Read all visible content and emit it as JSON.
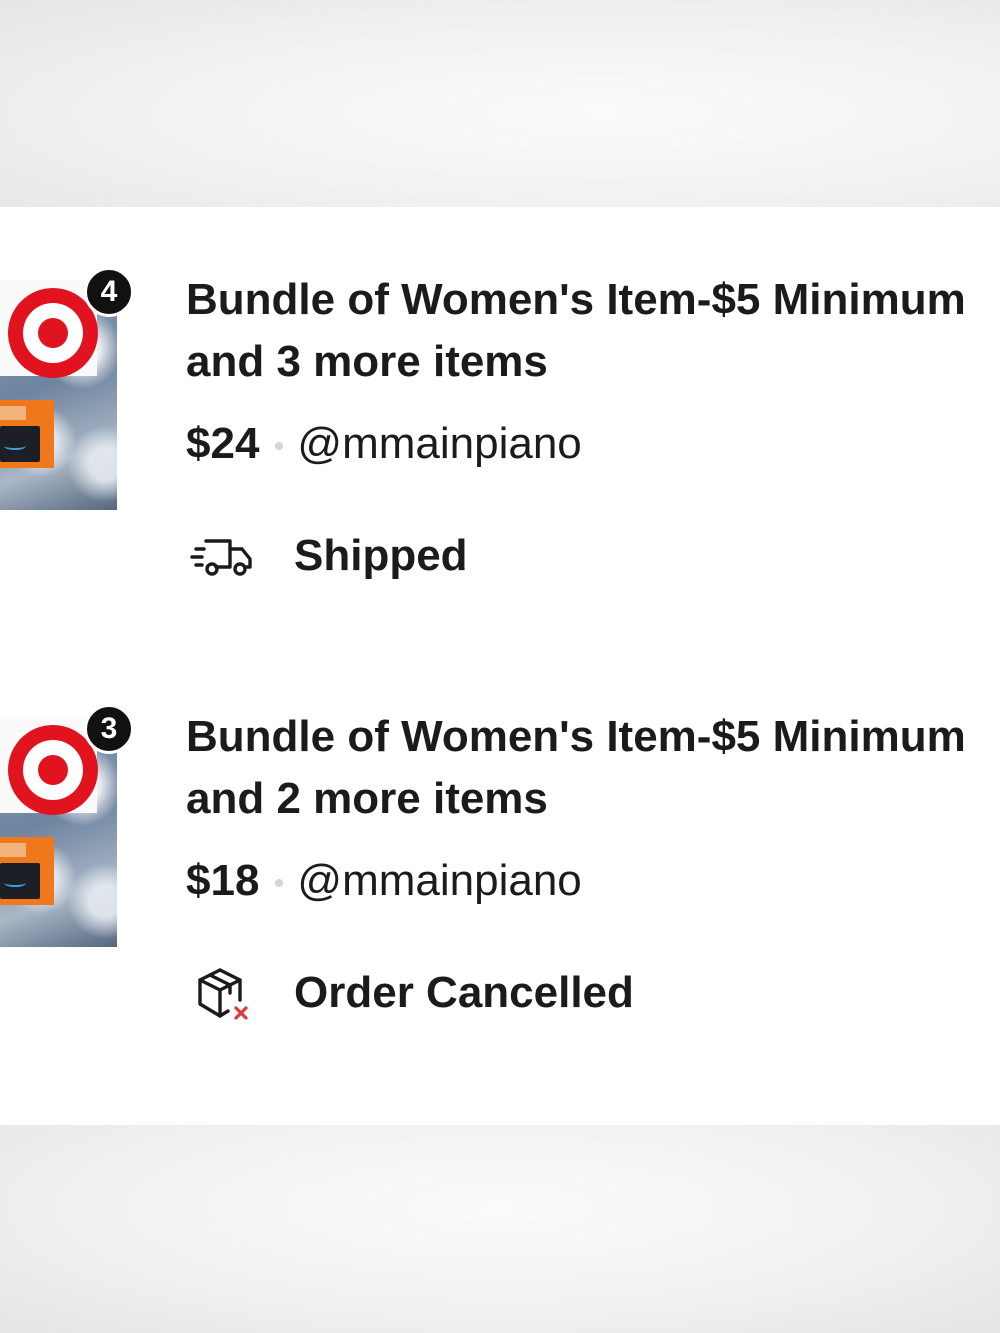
{
  "orders": [
    {
      "badge_count": "4",
      "title": "Bundle of Women's Item-$5 Minimum",
      "subtitle": "and 3 more items",
      "price": "$24",
      "seller": "@mmainpiano",
      "status": "Shipped",
      "status_icon": "truck-icon"
    },
    {
      "badge_count": "3",
      "title": "Bundle of Women's Item-$5 Minimum",
      "subtitle": "and 2 more items",
      "price": "$18",
      "seller": "@mmainpiano",
      "status": "Order Cancelled",
      "status_icon": "package-cancelled-icon"
    }
  ],
  "colors": {
    "status_cancel_mark": "#e0353b",
    "target_red": "#e1131f",
    "badge_bg": "#111111"
  }
}
